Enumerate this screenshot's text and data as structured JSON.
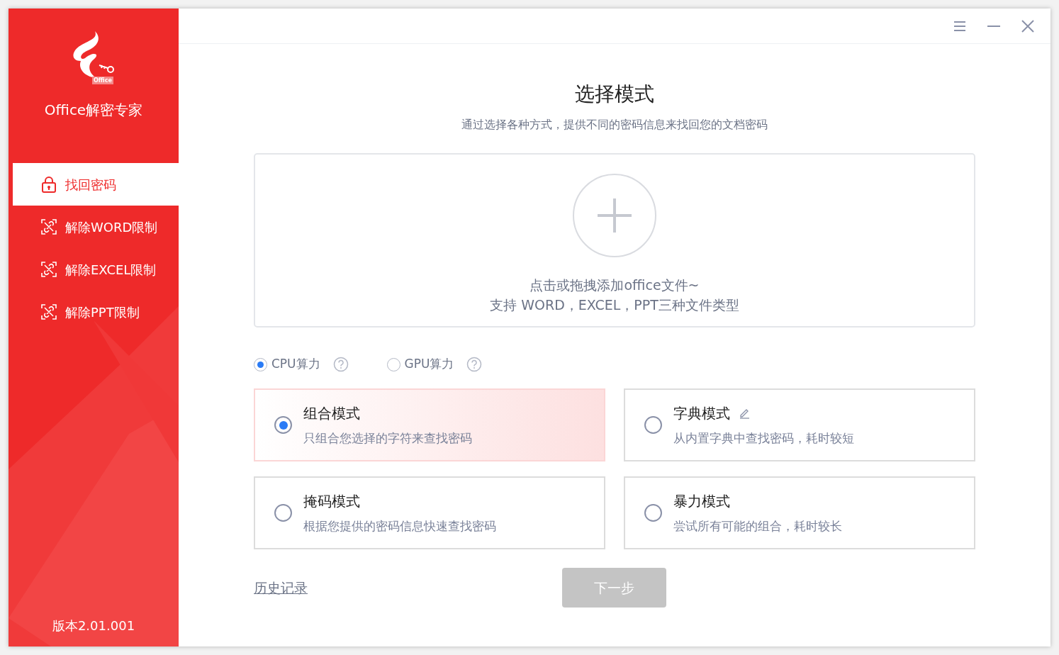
{
  "app": {
    "logo_badge": "Office",
    "name": "Office解密专家",
    "version": "版本2.01.001"
  },
  "nav": [
    {
      "label": "找回密码",
      "kind": "lock",
      "selected": true
    },
    {
      "label": "解除WORD限制",
      "kind": "unlock",
      "selected": false
    },
    {
      "label": "解除EXCEL限制",
      "kind": "unlock",
      "selected": false
    },
    {
      "label": "解除PPT限制",
      "kind": "unlock",
      "selected": false
    }
  ],
  "header": {
    "title": "选择模式",
    "subtitle": "通过选择各种方式，提供不同的密码信息来找回您的文档密码"
  },
  "dropzone": {
    "line1": "点击或拖拽添加office文件~",
    "line2": "支持 WORD，EXCEL，PPT三种文件类型"
  },
  "compute": [
    {
      "label": "CPU算力",
      "selected": true
    },
    {
      "label": "GPU算力",
      "selected": false
    }
  ],
  "modes": [
    {
      "title": "组合模式",
      "desc": "只组合您选择的字符来查找密码",
      "selected": true,
      "editable": false
    },
    {
      "title": "字典模式",
      "desc": "从内置字典中查找密码，耗时较短",
      "selected": false,
      "editable": true
    },
    {
      "title": "掩码模式",
      "desc": "根据您提供的密码信息快速查找密码",
      "selected": false,
      "editable": false
    },
    {
      "title": "暴力模式",
      "desc": "尝试所有可能的组合，耗时较长",
      "selected": false,
      "editable": false
    }
  ],
  "footer": {
    "history_link": "历史记录",
    "next_button": "下一步",
    "next_disabled": true
  }
}
